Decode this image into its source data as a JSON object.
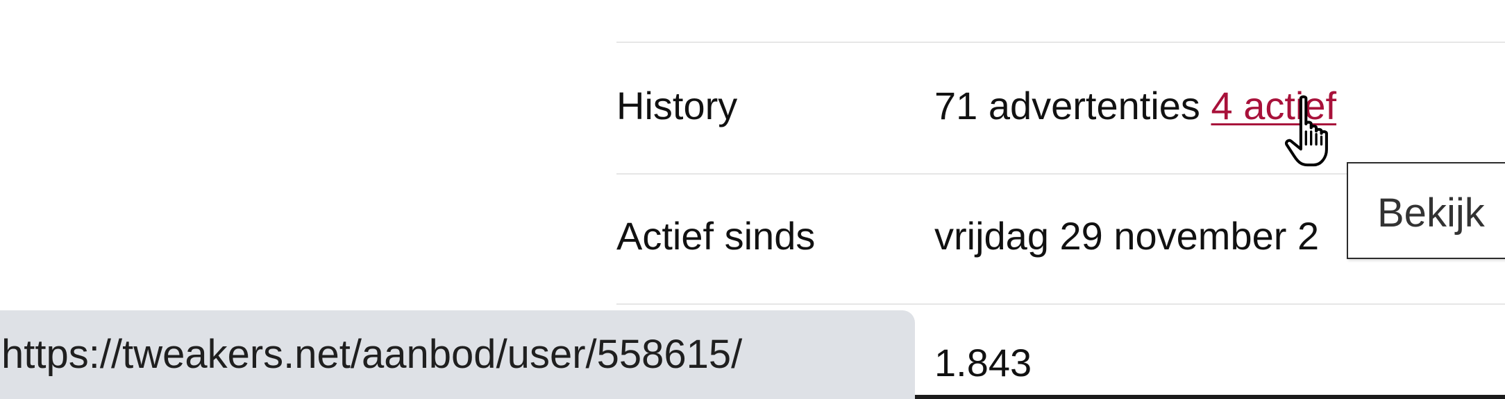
{
  "details": {
    "rows": [
      {
        "label": "History",
        "value_prefix": "71 advertenties",
        "link_text": "4 actief"
      },
      {
        "label": "Actief sinds",
        "value": "vrijdag 29 november 2"
      },
      {
        "label": "",
        "value": "1.843"
      }
    ]
  },
  "tooltip": {
    "text": "Bekijk"
  },
  "status_bar": {
    "url": "https://tweakers.net/aanbod/user/558615/"
  },
  "colors": {
    "link": "#a8113a",
    "divider": "#e6e6e6",
    "status_bar_bg": "#dee1e6"
  },
  "icons": {
    "cursor": "hand-pointer-icon"
  }
}
